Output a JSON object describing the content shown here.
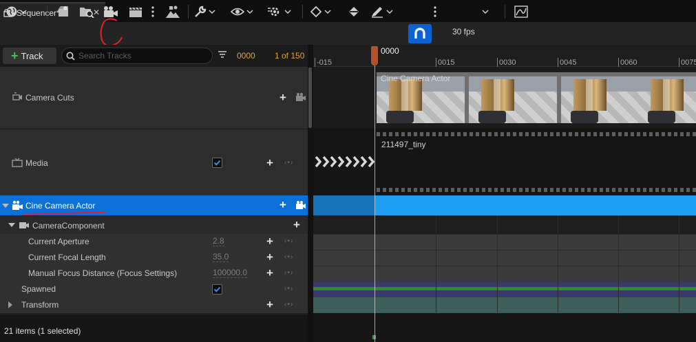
{
  "tab": {
    "title": "Sequencer*",
    "close": "✕"
  },
  "toolbar": {
    "icons": [
      "world-icon",
      "render-icon",
      "open-sequence-icon",
      "camera-icon",
      "clapper-icon",
      "more-icon",
      "actors-icon",
      "wrench-icon",
      "eye-icon",
      "gear-icon",
      "key-icon",
      "curve-icon",
      "brush-icon",
      "magnet-icon",
      "more-icon",
      "curve-editor-icon"
    ],
    "fps": "30 fps"
  },
  "trackbar": {
    "track_button": "Track",
    "search_placeholder": "Search Tracks",
    "current_frame": "0000",
    "frame_count": "1 of 150"
  },
  "outliner": {
    "camera_cuts": "Camera Cuts",
    "media": "Media",
    "actor": "Cine Camera Actor",
    "component": "CameraComponent",
    "properties": [
      {
        "label": "Current Aperture",
        "value": "2.8"
      },
      {
        "label": "Current Focal Length",
        "value": "35.0"
      },
      {
        "label": "Manual Focus Distance (Focus Settings)",
        "value": "100000.0"
      }
    ],
    "spawned": "Spawned",
    "transform": "Transform",
    "key_nav": "‹•›"
  },
  "status": {
    "text": "21 items (1 selected)"
  },
  "timeline": {
    "playhead_label": "0000",
    "ticks": [
      "-015",
      "0015",
      "0030",
      "0045",
      "0060",
      "0075"
    ],
    "camera_section_label": "Cine Camera Actor",
    "media_name": "211497_tiny"
  },
  "colors": {
    "accent": "#0b70d8",
    "selected_lane": "#1e9ef0",
    "frame_text": "#e0a43a",
    "playhead": "#b0522c",
    "annotation": "#e0202a"
  }
}
